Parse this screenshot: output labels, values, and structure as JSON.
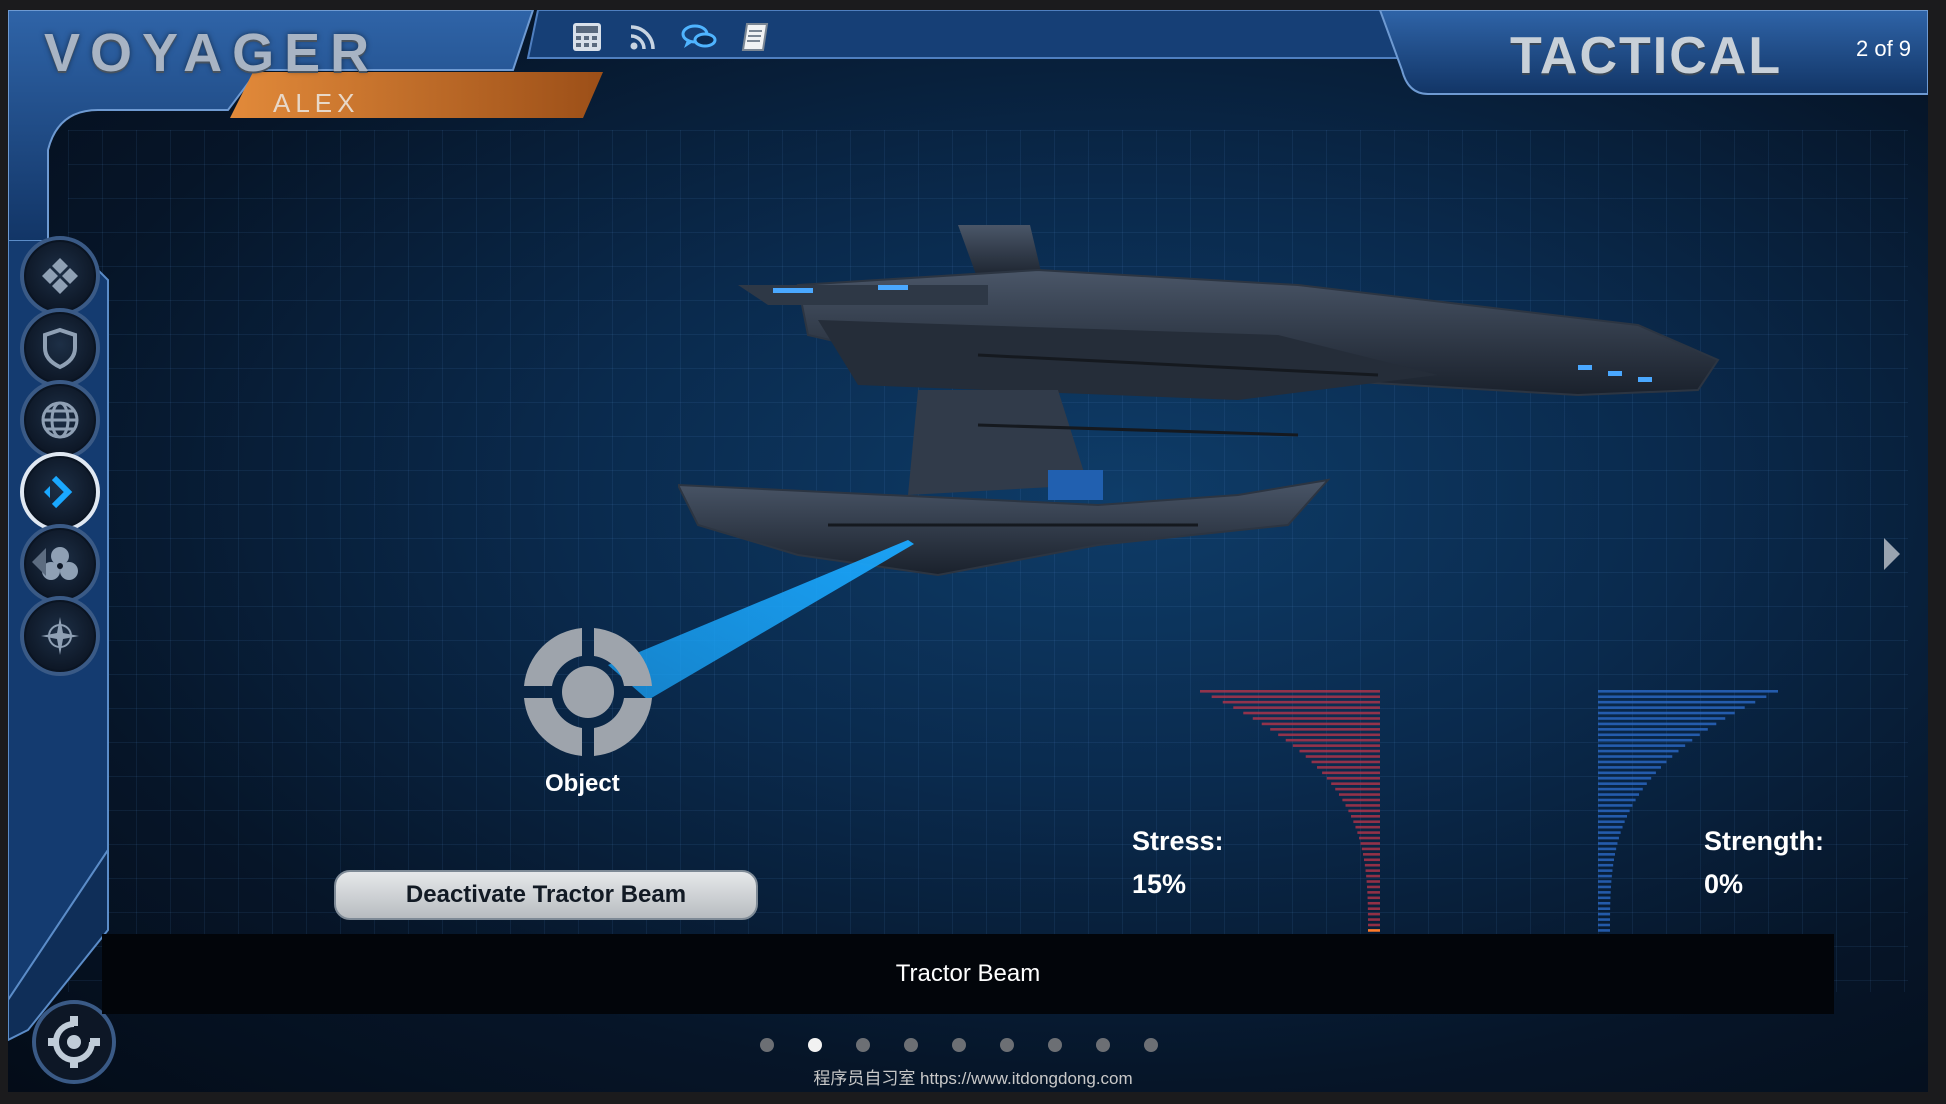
{
  "app": {
    "brand": "VOYAGER",
    "user": "ALEX",
    "section_title": "TACTICAL",
    "page_indicator": "2 of 9"
  },
  "toolbar": [
    {
      "name": "calculator-icon"
    },
    {
      "name": "rss-feed-icon"
    },
    {
      "name": "chat-bubbles-icon"
    },
    {
      "name": "notebook-icon"
    }
  ],
  "side_nav": [
    {
      "name": "nav-quad-icon",
      "active": false
    },
    {
      "name": "nav-shield-icon",
      "active": false
    },
    {
      "name": "nav-globe-icon",
      "active": false
    },
    {
      "name": "nav-chevron-icon",
      "active": true
    },
    {
      "name": "nav-trefoil-icon",
      "active": false
    },
    {
      "name": "nav-compass-icon",
      "active": false
    }
  ],
  "scene": {
    "object_label": "Object",
    "action_button": "Deactivate Tractor Beam",
    "stress": {
      "label": "Stress:",
      "value": "15%",
      "level": 0.15
    },
    "strength": {
      "label": "Strength:",
      "value": "0%",
      "level": 0.0
    },
    "caption": "Tractor Beam"
  },
  "pagination": {
    "total": 9,
    "current": 2
  },
  "watermark": "程序员自习室 https://www.itdongdong.com",
  "colors": {
    "frame_blue": "#1e4f8f",
    "frame_orange": "#c86a26",
    "beam": "#1aa8ff",
    "stress_bar": "#c0364a",
    "strength_bar": "#2e6fd0"
  }
}
